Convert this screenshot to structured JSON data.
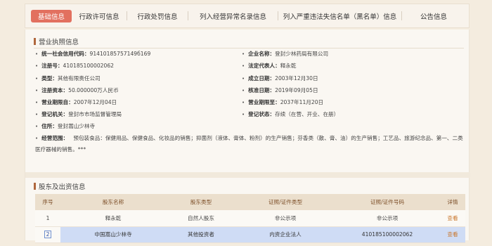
{
  "tabs": [
    "基础信息",
    "行政许可信息",
    "行政处罚信息",
    "列入经营异常名录信息",
    "列入严重违法失信名单（黑名单）信息",
    "公告信息"
  ],
  "license": {
    "section_title": "营业执照信息",
    "left": [
      {
        "label": "统一社会信用代码：",
        "value": "91410185757149б169"
      },
      {
        "label": "注册号：",
        "value": "410185100002062"
      },
      {
        "label": "类型：",
        "value": "其他有限责任公司"
      },
      {
        "label": "注册资本：",
        "value": "50.000000万人民币"
      },
      {
        "label": "营业期限自：",
        "value": "2007年12月04日"
      },
      {
        "label": "登记机关：",
        "value": "登封市市场监督管理局"
      },
      {
        "label": "住所：",
        "value": "登封嵩山少林寺"
      }
    ],
    "right": [
      {
        "label": "企业名称：",
        "value": "登封少林药局有限公司"
      },
      {
        "label": "法定代表人：",
        "value": "释永乾"
      },
      {
        "label": "成立日期：",
        "value": "2003年12月30日"
      },
      {
        "label": "核准日期：",
        "value": "2019年09月05日"
      },
      {
        "label": "营业期限至：",
        "value": "2037年11月20日"
      },
      {
        "label": "登记状态：",
        "value": "存续（在营、开业、在册）"
      }
    ],
    "scope_label": "经营范围：",
    "scope_text": "预包装食品：保健用品、保健食品、化妆品的销售；抑菌剂（液体、膏体、粉剂）的生产销售；芬香类（散、膏、油）的生产销售；工艺品、旅游纪念品、第一、二类医疗器械的销售。***"
  },
  "shareholders": {
    "section_title": "股东及出资信息",
    "headers": [
      "序号",
      "股东名称",
      "股东类型",
      "证照/证件类型",
      "证照/证件号码",
      "详情"
    ],
    "rows": [
      [
        "1",
        "释永乾",
        "自然人股东",
        "非公示项",
        "非公示项",
        "查看"
      ],
      [
        "2",
        "中国嵩山少林寺",
        "其他投资者",
        "内资企业法人",
        "410185100002062",
        "查看"
      ]
    ]
  },
  "colors": {
    "active_tab": "#e2705f",
    "accent_bar": "#b0673d",
    "header_text": "#7c4e27",
    "link": "#c9782f",
    "selection": "#cfdcf5"
  }
}
